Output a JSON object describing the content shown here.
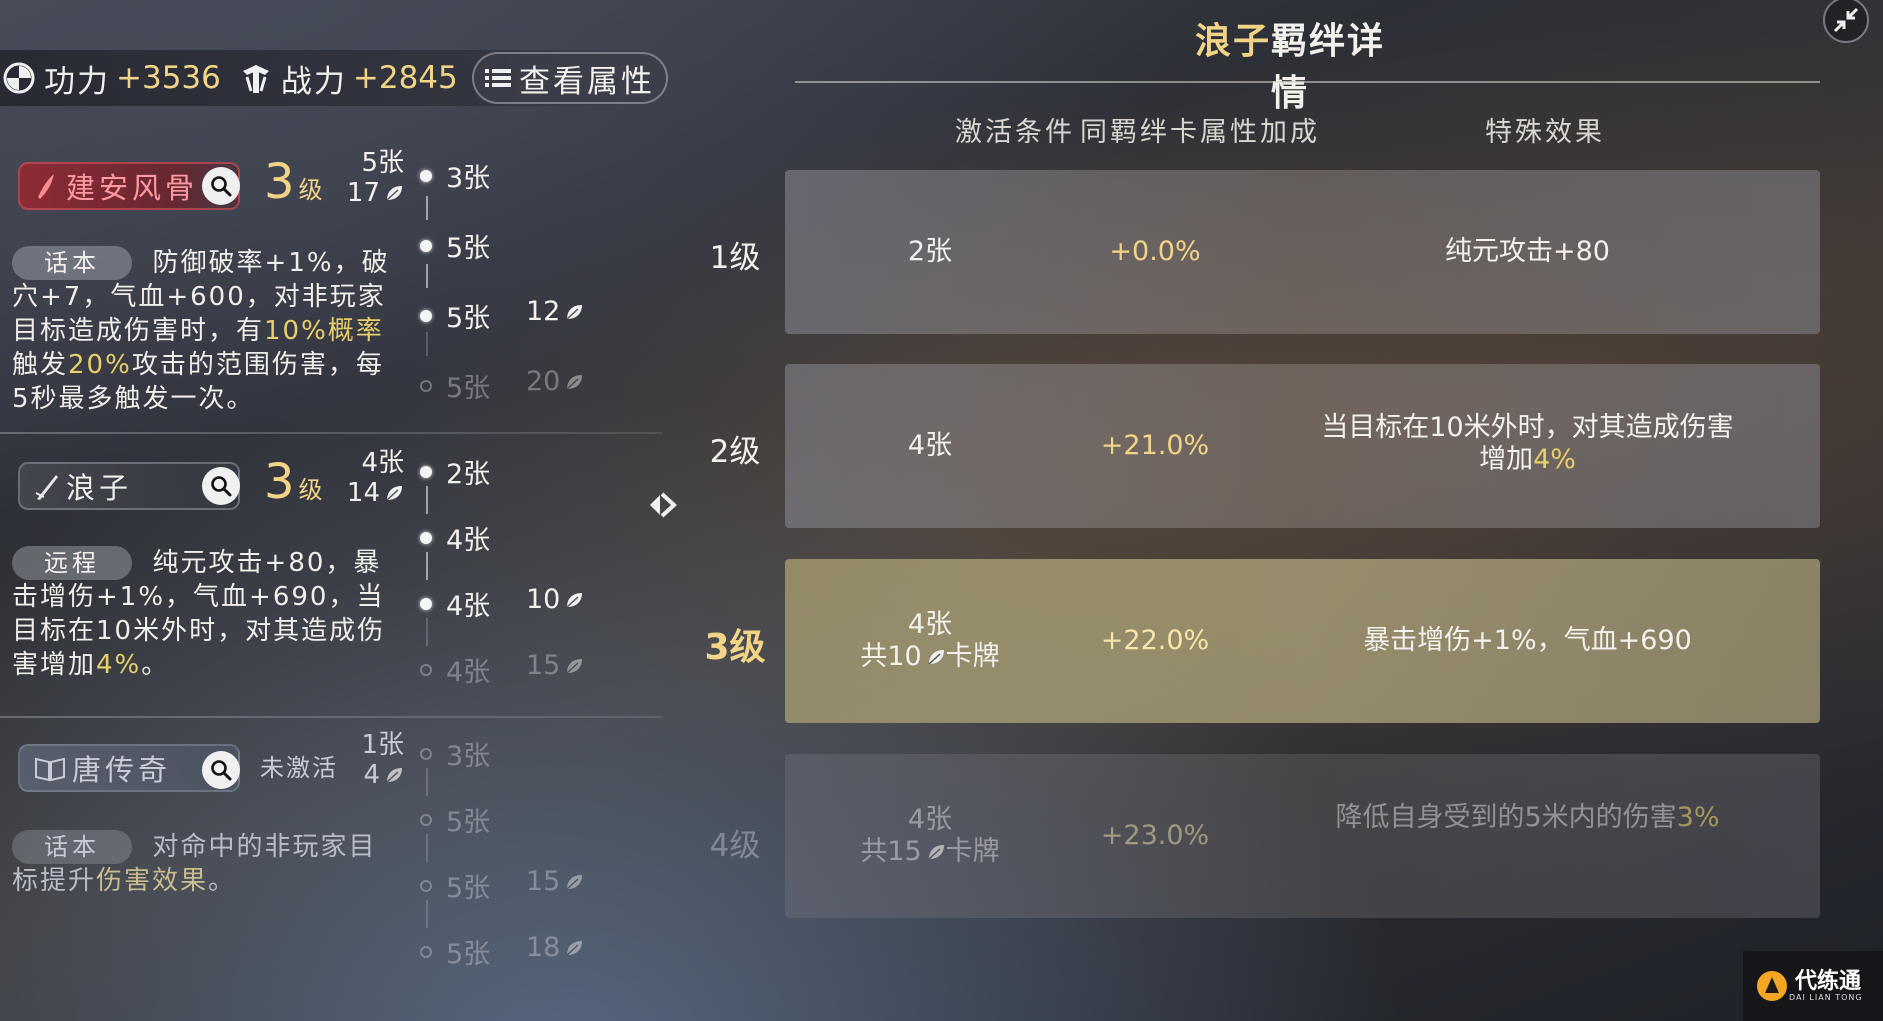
{
  "stats": {
    "power_label": "功力",
    "power_value": "+3536",
    "combat_label": "战力",
    "combat_value": "+2845",
    "view_attrs_label": "查看属性"
  },
  "bonds": [
    {
      "name": "建安风骨",
      "level_num": "3",
      "level_unit": "级",
      "count_cards": "5张",
      "count_leaves": "17",
      "tag": "话本",
      "desc_pre": "防御破率+1%，破穴+7，气血+600，对非玩家目标造成伤害时，有",
      "desc_hl1": "10%概率",
      "desc_mid": "触发",
      "desc_hl2": "20%",
      "desc_post": "攻击的范围伤害，每5秒最多触发一次。",
      "tiers": [
        {
          "cards": "3张",
          "leaves": "",
          "active": true
        },
        {
          "cards": "5张",
          "leaves": "",
          "active": true
        },
        {
          "cards": "5张",
          "leaves": "12",
          "active": true
        },
        {
          "cards": "5张",
          "leaves": "20",
          "active": false
        }
      ]
    },
    {
      "name": "浪子",
      "level_num": "3",
      "level_unit": "级",
      "count_cards": "4张",
      "count_leaves": "14",
      "tag": "远程",
      "desc_pre": "纯元攻击+80，暴击增伤+1%，气血+690，当目标在10米外时，对其造成伤害增加",
      "desc_hl1": "4%",
      "desc_post": "。",
      "tiers": [
        {
          "cards": "2张",
          "leaves": "",
          "active": true
        },
        {
          "cards": "4张",
          "leaves": "",
          "active": true
        },
        {
          "cards": "4张",
          "leaves": "10",
          "active": true
        },
        {
          "cards": "4张",
          "leaves": "15",
          "active": false
        }
      ]
    },
    {
      "name": "唐传奇",
      "status": "未激活",
      "count_cards": "1张",
      "count_leaves": "4",
      "tag": "话本",
      "desc_pre": "对命中的非玩家目标提升",
      "desc_hl1": "伤害效果",
      "desc_post": "。",
      "tiers": [
        {
          "cards": "3张",
          "leaves": "",
          "active": false
        },
        {
          "cards": "5张",
          "leaves": "",
          "active": false
        },
        {
          "cards": "5张",
          "leaves": "15",
          "active": false
        },
        {
          "cards": "5张",
          "leaves": "18",
          "active": false
        }
      ]
    }
  ],
  "detail": {
    "title_hl": "浪子",
    "title_rest": "羁绊详情",
    "col_condition": "激活条件",
    "col_bonus": "同羁绊卡属性加成",
    "col_effect": "特殊效果",
    "levels": [
      {
        "label": "1级",
        "cards": "2张",
        "total_pre": "",
        "total_leaves": "",
        "total_post": "",
        "bonus": "+0.0%",
        "effect_pre": "纯元攻击+80",
        "effect_hl": "",
        "state": "normal"
      },
      {
        "label": "2级",
        "cards": "4张",
        "total_pre": "",
        "total_leaves": "",
        "total_post": "",
        "bonus": "+21.0%",
        "effect_pre": "当目标在10米外时，对其造成伤害增加",
        "effect_hl": "4%",
        "state": "normal"
      },
      {
        "label": "3级",
        "cards": "4张",
        "total_pre": "共",
        "total_leaves": "10",
        "total_post": "卡牌",
        "bonus": "+22.0%",
        "effect_pre": "暴击增伤+1%，气血+690",
        "effect_hl": "",
        "state": "current"
      },
      {
        "label": "4级",
        "cards": "4张",
        "total_pre": "共",
        "total_leaves": "15",
        "total_post": "卡牌",
        "bonus": "+23.0%",
        "effect_pre": "降低自身受到的5米内的伤害",
        "effect_hl": "3%",
        "state": "off"
      }
    ]
  },
  "watermark": {
    "text": "代练通",
    "sub": "DAI LIAN TONG"
  },
  "colors": {
    "gold": "#f2d487",
    "highlight": "#e8cf6a",
    "active_card": "#a89a6e"
  }
}
